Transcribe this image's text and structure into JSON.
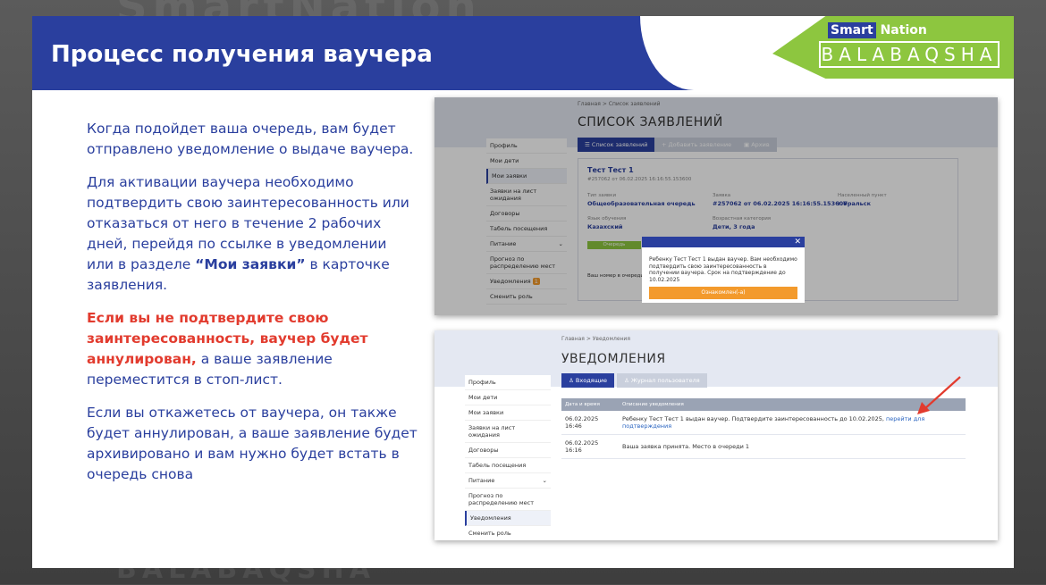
{
  "slide": {
    "title": "Процесс получения ваучера",
    "logo": {
      "top_smart": "Smart",
      "top_nation": "Nation",
      "bottom": "BALABAQSHA"
    },
    "colors": {
      "primary": "#2a3f9e",
      "accent_green": "#8dc63f",
      "warning_red": "#e23b2e"
    }
  },
  "text": {
    "p1": "Когда подойдет ваша очередь, вам будет отправлено уведомление о выдаче ваучера.",
    "p2_start": "Для активации ваучера необходимо подтвердить свою заинтересованность или отказаться от него в течение 2 рабочих дней, перейдя по ссылке в уведомлении или в разделе ",
    "p2_bold": "“Мои заявки”",
    "p2_end": " в карточке заявления.",
    "p3_red": "Если вы не подтвердите свою заинтересованность, ваучер будет аннулирован,",
    "p3_end": " а ваше заявление переместится в стоп-лист.",
    "p4": "Если вы откажетесь от ваучера, он также будет аннулирован, а ваше заявление будет архивировано и вам нужно будет встать в очередь снова"
  },
  "shot1": {
    "breadcrumb": "Главная  >  Список заявлений",
    "heading": "СПИСОК ЗАЯВЛЕНИЙ",
    "sidebar": [
      "Профиль",
      "Мои дети",
      "Мои заявки",
      "Заявки на лист ожидания",
      "Договоры",
      "Табель посещения",
      "Питание",
      "Прогноз по распределению мест",
      "Уведомления",
      "Сменить роль"
    ],
    "tabs": [
      "Список заявлений",
      "Добавить заявление",
      "Архив"
    ],
    "card": {
      "name": "Тест Тест 1",
      "sub": "#257062 от 06.02.2025 16:16:55.153600",
      "type_label": "Тип заявки",
      "type_value": "Общеобразовательная очередь",
      "app_label": "Заявка",
      "app_value": "#257062 от 06.02.2025 16:16:55.153600",
      "city_label": "Населенный пункт",
      "city_value": "г.Уральск",
      "lang_label": "Язык обучения",
      "lang_value": "Казахский",
      "age_label": "Возрастная категория",
      "age_value": "Дети, 3 года",
      "queue_label": "Очередь",
      "queue_number_label": "Ваш номер в очереди"
    },
    "modal": {
      "text": "Ребенку Тест Тест 1 выдан ваучер. Вам необходимо подтвердить свою заинтересованность в получении ваучера. Срок на подтверждение до 10.02.2025",
      "button": "Ознакомлен(-а)"
    },
    "badge": "1"
  },
  "shot2": {
    "breadcrumb": "Главная  >  Уведомления",
    "heading": "УВЕДОМЛЕНИЯ",
    "sidebar": [
      "Профиль",
      "Мои дети",
      "Мои заявки",
      "Заявки на лист ожидания",
      "Договоры",
      "Табель посещения",
      "Питание",
      "Прогноз по распределению мест",
      "Уведомления",
      "Сменить роль"
    ],
    "tabs": [
      "Входящие",
      "Журнал пользователя"
    ],
    "table": {
      "headers": [
        "Дата и время",
        "Описание уведомления"
      ],
      "rows": [
        {
          "date": "06.02.2025 16:46",
          "desc": "Ребенку Тест Тест 1 выдан ваучер. Подтвердите заинтересованность до 10.02.2025,",
          "link": "перейти для подтверждения"
        },
        {
          "date": "06.02.2025 16:16",
          "desc": "Ваша заявка принята. Место в очереди 1",
          "link": ""
        }
      ]
    }
  }
}
